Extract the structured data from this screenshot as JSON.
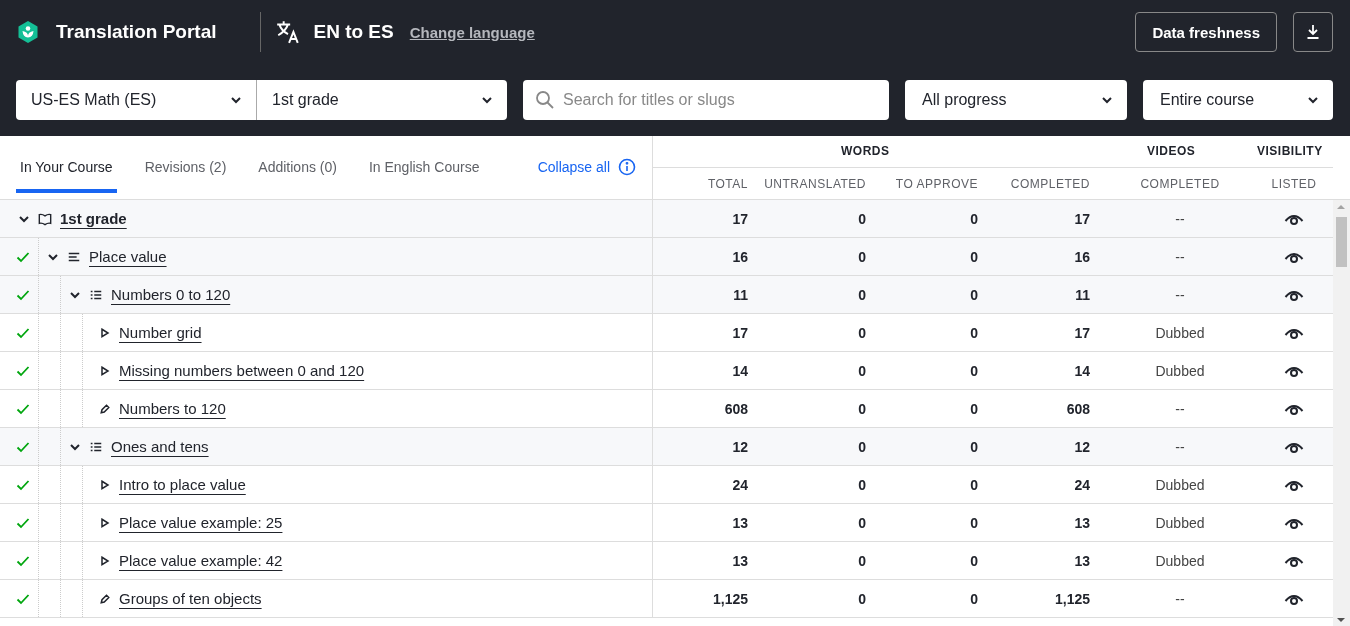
{
  "header": {
    "brand": "Translation Portal",
    "language": "EN to ES",
    "change_language": "Change language",
    "data_freshness": "Data freshness"
  },
  "filters": {
    "course": "US-ES Math (ES)",
    "grade": "1st grade",
    "search_placeholder": "Search for titles or slugs",
    "progress": "All progress",
    "scope": "Entire course"
  },
  "tabs": [
    {
      "label": "In Your Course",
      "selected": true
    },
    {
      "label": "Revisions (2)",
      "selected": false
    },
    {
      "label": "Additions (0)",
      "selected": false
    },
    {
      "label": "In English Course",
      "selected": false
    }
  ],
  "collapse_all": "Collapse all",
  "column_groups": [
    "WORDS",
    "VIDEOS",
    "VISIBILITY"
  ],
  "columns": [
    "TOTAL",
    "UNTRANSLATED",
    "TO APPROVE",
    "COMPLETED",
    "COMPLETED",
    "LISTED"
  ],
  "tree": [
    {
      "kind": "course",
      "title": "1st grade",
      "done": false,
      "expanded": true,
      "total": "17",
      "untranslated": "0",
      "to_approve": "0",
      "completed": "17",
      "videos": "--",
      "listed": true,
      "children": [
        {
          "kind": "unit",
          "title": "Place value",
          "done": true,
          "expanded": true,
          "total": "16",
          "untranslated": "0",
          "to_approve": "0",
          "completed": "16",
          "videos": "--",
          "listed": true,
          "children": [
            {
              "kind": "lesson",
              "title": "Numbers 0 to 120",
              "done": true,
              "expanded": true,
              "total": "11",
              "untranslated": "0",
              "to_approve": "0",
              "completed": "11",
              "videos": "--",
              "listed": true,
              "children": [
                {
                  "kind": "video",
                  "title": "Number grid",
                  "done": true,
                  "total": "17",
                  "untranslated": "0",
                  "to_approve": "0",
                  "completed": "17",
                  "videos": "Dubbed",
                  "listed": true
                },
                {
                  "kind": "video",
                  "title": "Missing numbers between 0 and 120",
                  "done": true,
                  "total": "14",
                  "untranslated": "0",
                  "to_approve": "0",
                  "completed": "14",
                  "videos": "Dubbed",
                  "listed": true
                },
                {
                  "kind": "exercise",
                  "title": "Numbers to 120",
                  "done": true,
                  "total": "608",
                  "untranslated": "0",
                  "to_approve": "0",
                  "completed": "608",
                  "videos": "--",
                  "listed": true
                }
              ]
            },
            {
              "kind": "lesson",
              "title": "Ones and tens",
              "done": true,
              "expanded": true,
              "total": "12",
              "untranslated": "0",
              "to_approve": "0",
              "completed": "12",
              "videos": "--",
              "listed": true,
              "children": [
                {
                  "kind": "video",
                  "title": "Intro to place value",
                  "done": true,
                  "total": "24",
                  "untranslated": "0",
                  "to_approve": "0",
                  "completed": "24",
                  "videos": "Dubbed",
                  "listed": true
                },
                {
                  "kind": "video",
                  "title": "Place value example: 25",
                  "done": true,
                  "total": "13",
                  "untranslated": "0",
                  "to_approve": "0",
                  "completed": "13",
                  "videos": "Dubbed",
                  "listed": true
                },
                {
                  "kind": "video",
                  "title": "Place value example: 42",
                  "done": true,
                  "total": "13",
                  "untranslated": "0",
                  "to_approve": "0",
                  "completed": "13",
                  "videos": "Dubbed",
                  "listed": true
                },
                {
                  "kind": "exercise",
                  "title": "Groups of ten objects",
                  "done": true,
                  "total": "1,125",
                  "untranslated": "0",
                  "to_approve": "0",
                  "completed": "1,125",
                  "videos": "--",
                  "listed": true
                }
              ]
            }
          ]
        }
      ]
    }
  ]
}
